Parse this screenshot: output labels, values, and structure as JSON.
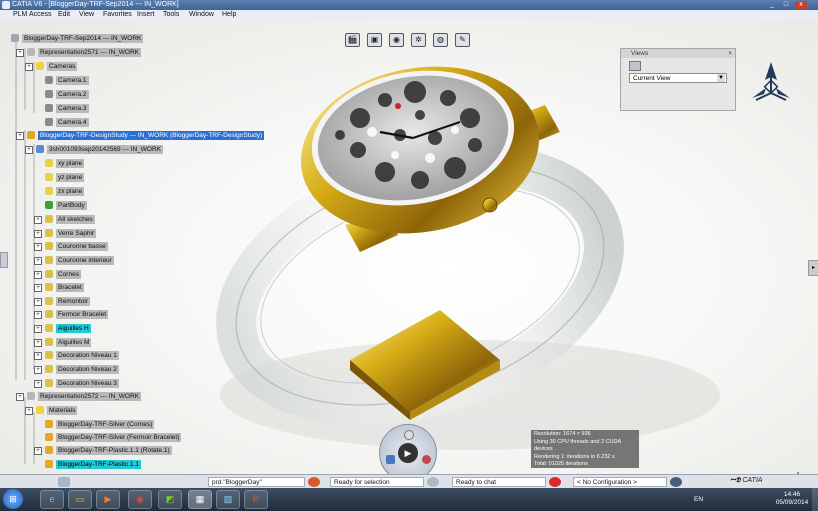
{
  "window": {
    "title": "CATIA V6 - [BloggerDay-TRF-Sep2014 --- IN_WORK]",
    "minimize": "_",
    "restore": "□",
    "close": "x"
  },
  "menubar": {
    "items": [
      "PLM Access",
      "Edit",
      "View",
      "Favorites",
      "Insert",
      "Tools",
      "Window",
      "Help"
    ]
  },
  "tree": [
    {
      "label": "BloggerDay-TRF-Sep2014 --- IN_WORK",
      "style": "normal",
      "icon": "product-icon",
      "iconColor": "#9aa6b4"
    },
    {
      "label": "Representation2571 --- IN_WORK",
      "style": "normal",
      "icon": "representation-icon",
      "iconColor": "#b8b8b8"
    },
    {
      "label": "Cameras",
      "style": "normal",
      "icon": "folder-icon",
      "iconColor": "#f2d23c"
    },
    {
      "label": "Camera.1",
      "style": "normal",
      "icon": "camera-icon",
      "iconColor": "#8b8b8b"
    },
    {
      "label": "Camera.2",
      "style": "normal",
      "icon": "camera-icon",
      "iconColor": "#8b8b8b"
    },
    {
      "label": "Camera.3",
      "style": "normal",
      "icon": "camera-icon",
      "iconColor": "#8b8b8b"
    },
    {
      "label": "Camera.4",
      "style": "normal",
      "icon": "camera-icon",
      "iconColor": "#8b8b8b"
    },
    {
      "label": "BloggerDay-TRF-DesignStudy --- IN_WORK (BloggerDay-TRF-DesignStudy)",
      "style": "selected",
      "icon": "product-icon",
      "iconColor": "#e0a81c"
    },
    {
      "label": "3sh001093sep20142569 --- IN_WORK",
      "style": "normal",
      "icon": "part-icon",
      "iconColor": "#5a8ad0"
    },
    {
      "label": "xy plane",
      "style": "normal",
      "icon": "plane-icon",
      "iconColor": "#e8d24a"
    },
    {
      "label": "yz plane",
      "style": "normal",
      "icon": "plane-icon",
      "iconColor": "#e8d24a"
    },
    {
      "label": "zx plane",
      "style": "normal",
      "icon": "plane-icon",
      "iconColor": "#e8d24a"
    },
    {
      "label": "PartBody",
      "style": "normal",
      "icon": "partbody-icon",
      "iconColor": "#3aa03a"
    },
    {
      "label": "All sketches",
      "style": "normal",
      "icon": "geometrical-set-icon",
      "iconColor": "#d9c24a"
    },
    {
      "label": "Verre Saphir",
      "style": "normal",
      "icon": "geometrical-set-icon",
      "iconColor": "#d9c24a"
    },
    {
      "label": "Couronne basse",
      "style": "normal",
      "icon": "geometrical-set-icon",
      "iconColor": "#d9c24a"
    },
    {
      "label": "Couronne interieur",
      "style": "normal",
      "icon": "geometrical-set-icon",
      "iconColor": "#d9c24a"
    },
    {
      "label": "Cornes",
      "style": "normal",
      "icon": "geometrical-set-icon",
      "iconColor": "#d9c24a"
    },
    {
      "label": "Bracelet",
      "style": "normal",
      "icon": "geometrical-set-icon",
      "iconColor": "#d9c24a"
    },
    {
      "label": "Remontoir",
      "style": "normal",
      "icon": "geometrical-set-icon",
      "iconColor": "#d9c24a"
    },
    {
      "label": "Fermoir Bracelet",
      "style": "normal",
      "icon": "geometrical-set-icon",
      "iconColor": "#d9c24a"
    },
    {
      "label": "Aiguilles H",
      "style": "cyan",
      "icon": "geometrical-set-icon",
      "iconColor": "#d9c24a"
    },
    {
      "label": "Aiguilles M",
      "style": "normal",
      "icon": "geometrical-set-icon",
      "iconColor": "#d9c24a"
    },
    {
      "label": "Decoration Niveau 1",
      "style": "normal",
      "icon": "geometrical-set-icon",
      "iconColor": "#d9c24a"
    },
    {
      "label": "Decoration Niveau 2",
      "style": "normal",
      "icon": "geometrical-set-icon",
      "iconColor": "#d9c24a"
    },
    {
      "label": "Decoration Niveau 3",
      "style": "normal",
      "icon": "geometrical-set-icon",
      "iconColor": "#d9c24a"
    },
    {
      "label": "Representation2572 --- IN_WORK",
      "style": "normal",
      "icon": "representation-icon",
      "iconColor": "#b8b8b8"
    },
    {
      "label": "Materials",
      "style": "normal",
      "icon": "folder-icon",
      "iconColor": "#f2d23c"
    },
    {
      "label": "BloggerDay-TRF-Silver (Cornes)",
      "style": "normal",
      "icon": "material-icon",
      "iconColor": "#e6a626"
    },
    {
      "label": "BloggerDay-TRF-Silver (Fermoir Bracelet)",
      "style": "normal",
      "icon": "material-icon",
      "iconColor": "#e6a626"
    },
    {
      "label": "BloggerDay-TRF-Plastic.1.1 (Rotate.1)",
      "style": "normal",
      "icon": "material-icon",
      "iconColor": "#e6a626"
    },
    {
      "label": "BloggerDay-TRF-Plastic.1.1",
      "style": "cyan",
      "icon": "material-icon",
      "iconColor": "#e6a626"
    }
  ],
  "top_tools": [
    "clapper-icon",
    "image-icon",
    "camera-icon",
    "settings-icon",
    "globe-icon",
    "ruler-icon"
  ],
  "views_panel": {
    "title": "Views",
    "selected": "Current View",
    "dropdown_arrow": "▼"
  },
  "render_info": [
    "Resolution: 1674 × 936",
    "Using 30 CPU threads and 2 CUDA devices",
    "Rendering 1: iterations in 6.232 s",
    "Total: 01025 iterations"
  ],
  "render_controls": {
    "play_label": "▶"
  },
  "status": {
    "command": "prd.\"BloggerDay\"",
    "selection": "Ready for selection",
    "chat": "Ready to chat",
    "config": "< No Configuration >",
    "brand": "CATIA"
  },
  "taskbar": {
    "language": "EN",
    "time": "14:46",
    "date": "05/09/2014",
    "apps": [
      "ie-icon",
      "explorer-icon",
      "media-player-icon",
      "chrome-icon",
      "nvidia-icon",
      "catia-icon",
      "paint-icon",
      "powerpoint-icon"
    ]
  },
  "colors": {
    "selection": "#2a6fd6",
    "highlight": "#22c9d6",
    "gold": "#d8b01a"
  }
}
